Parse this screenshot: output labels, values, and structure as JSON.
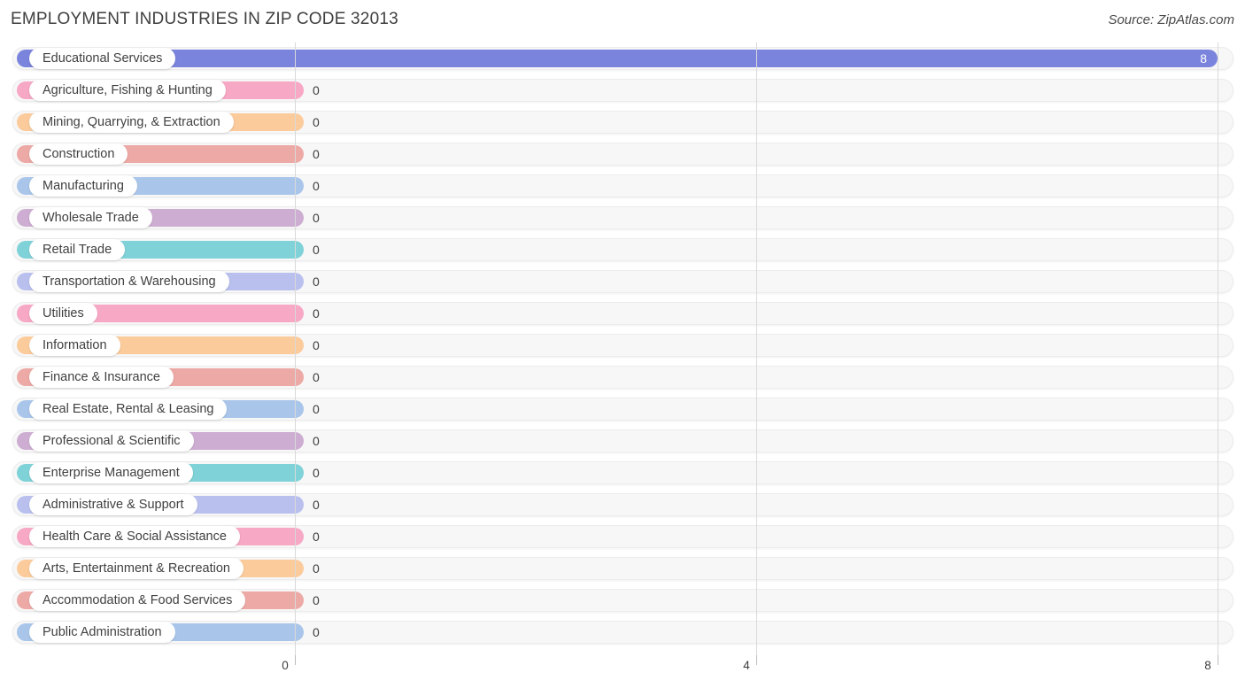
{
  "header": {
    "title": "EMPLOYMENT INDUSTRIES IN ZIP CODE 32013",
    "source": "Source: ZipAtlas.com"
  },
  "chart_data": {
    "type": "bar",
    "orientation": "horizontal",
    "title": "EMPLOYMENT INDUSTRIES IN ZIP CODE 32013",
    "xlabel": "",
    "ylabel": "",
    "xlim": [
      0,
      8
    ],
    "ticks": [
      0,
      4,
      8
    ],
    "tick_labels": [
      "0",
      "4",
      "8"
    ],
    "grid": true,
    "legend": "none",
    "categories": [
      "Educational Services",
      "Agriculture, Fishing & Hunting",
      "Mining, Quarrying, & Extraction",
      "Construction",
      "Manufacturing",
      "Wholesale Trade",
      "Retail Trade",
      "Transportation & Warehousing",
      "Utilities",
      "Information",
      "Finance & Insurance",
      "Real Estate, Rental & Leasing",
      "Professional & Scientific",
      "Enterprise Management",
      "Administrative & Support",
      "Health Care & Social Assistance",
      "Arts, Entertainment & Recreation",
      "Accommodation & Food Services",
      "Public Administration"
    ],
    "values": [
      8,
      0,
      0,
      0,
      0,
      0,
      0,
      0,
      0,
      0,
      0,
      0,
      0,
      0,
      0,
      0,
      0,
      0,
      0
    ],
    "value_labels": [
      "8",
      "0",
      "0",
      "0",
      "0",
      "0",
      "0",
      "0",
      "0",
      "0",
      "0",
      "0",
      "0",
      "0",
      "0",
      "0",
      "0",
      "0",
      "0"
    ],
    "colors": [
      "#7b84dd",
      "#f7a8c4",
      "#fbcb9c",
      "#eda9a5",
      "#a9c6ea",
      "#cdaed2",
      "#7fd2d8",
      "#b9c0ee",
      "#f7a8c4",
      "#fbcb9c",
      "#eda9a5",
      "#a9c6ea",
      "#cdaed2",
      "#7fd2d8",
      "#b9c0ee",
      "#f7a8c4",
      "#fbcb9c",
      "#eda9a5",
      "#a9c6ea"
    ]
  }
}
